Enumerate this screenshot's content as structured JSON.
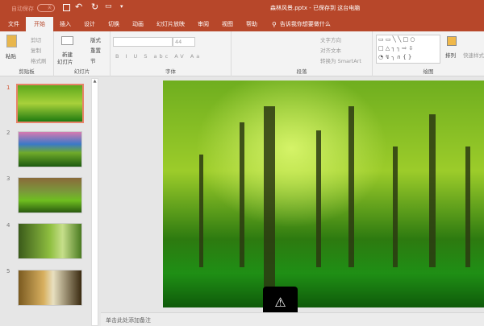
{
  "titlebar": {
    "autosave": "自动保存",
    "autosave_state": "关",
    "title": "森林风景.pptx - 已保存到 这台电脑"
  },
  "tabs": [
    {
      "label": "文件"
    },
    {
      "label": "开始"
    },
    {
      "label": "插入"
    },
    {
      "label": "设计"
    },
    {
      "label": "切换"
    },
    {
      "label": "动画"
    },
    {
      "label": "幻灯片放映"
    },
    {
      "label": "审阅"
    },
    {
      "label": "视图"
    },
    {
      "label": "帮助"
    }
  ],
  "tell_me": "告诉我你想要做什么",
  "ribbon": {
    "clipboard": {
      "paste": "粘贴",
      "cut": "剪切",
      "copy": "复制",
      "format_painter": "格式刷",
      "label": "剪贴板"
    },
    "slides": {
      "new_slide": "新建",
      "new_slide2": "幻灯片",
      "layout": "版式",
      "reset": "重置",
      "section": "节",
      "label": "幻灯片"
    },
    "font": {
      "font_size": "44",
      "label": "字体"
    },
    "paragraph": {
      "text_direction": "文字方向",
      "align_text": "对齐文本",
      "smartart": "转换为 SmartArt",
      "label": "段落"
    },
    "drawing": {
      "arrange": "排列",
      "quick_styles": "快速样式",
      "label": "绘图"
    }
  },
  "thumbnails": [
    {
      "num": "1"
    },
    {
      "num": "2"
    },
    {
      "num": "3"
    },
    {
      "num": "4"
    },
    {
      "num": "5"
    }
  ],
  "notes_placeholder": "单击此处添加备注"
}
